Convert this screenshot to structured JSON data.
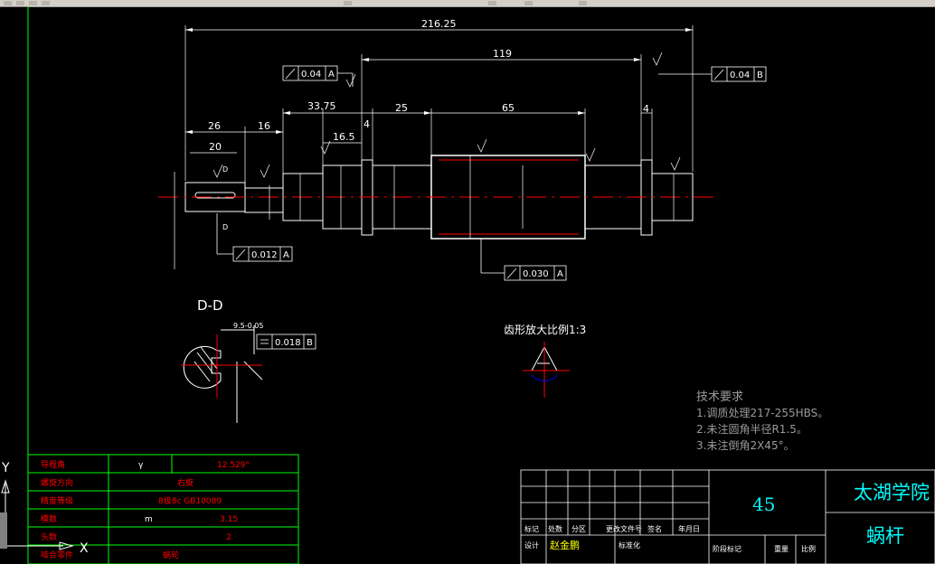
{
  "drawing": {
    "dims": {
      "overall": "216.25",
      "main_span": "119",
      "d26": "26",
      "d20": "20",
      "d16": "16",
      "d3375": "33.75",
      "d4a": "4",
      "d25": "25",
      "d65": "65",
      "d4b": "4",
      "d165": "16.5",
      "section_w": "9.5-0.05"
    },
    "tolerances": {
      "t1": "0.04",
      "t1_ref": "A",
      "t2": "0.04",
      "t2_ref": "B",
      "t3": "0.012",
      "t3_ref": "A",
      "t4": "0.030",
      "t4_ref": "A",
      "t5": "0.018",
      "t5_ref": "B"
    },
    "section_label": "D-D",
    "section_mark": "D",
    "tooth_caption": "齿形放大比例1:3",
    "tech_req": {
      "title": "技术要求",
      "line1": "1.调质处理217-255HBS。",
      "line2": "2.未注圆角半径R1.5。",
      "line3": "3.未注倒角2X45°。"
    }
  },
  "params_table": {
    "rows": [
      {
        "label": "导程角",
        "sym": "γ",
        "value": "12.529°"
      },
      {
        "label": "螺旋方向",
        "sym": "",
        "value": "右旋"
      },
      {
        "label": "精度等级",
        "sym": "",
        "value": "8级8c GB10089"
      },
      {
        "label": "模数",
        "sym": "m",
        "value": "3.15"
      },
      {
        "label": "头数",
        "sym": "",
        "value": "2"
      },
      {
        "label": "啮合零件",
        "sym": "",
        "value": "蜗轮"
      }
    ]
  },
  "title_block": {
    "material": "45",
    "school": "太湖学院",
    "part_name": "蜗杆",
    "designer_label": "设计",
    "designer": "赵金鹏",
    "standard_label": "标准化",
    "headers": [
      "标记",
      "处数",
      "分区",
      "更改文件号",
      "签名",
      "年月日"
    ],
    "stage_headers": [
      "阶段标记",
      "重量",
      "比例"
    ]
  },
  "ucs": {
    "x": "X",
    "y": "Y"
  }
}
